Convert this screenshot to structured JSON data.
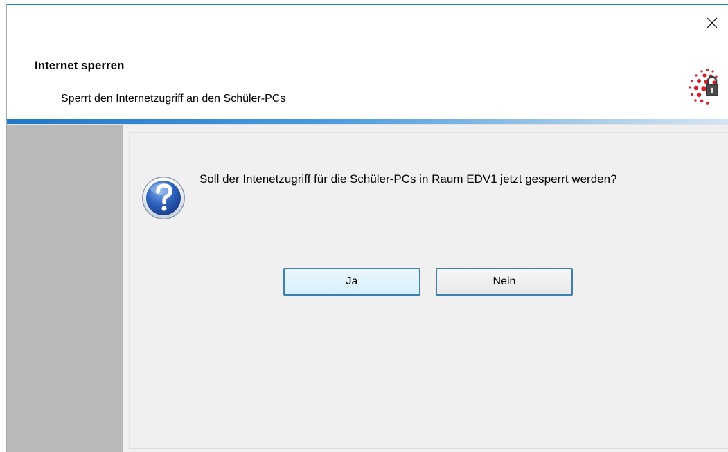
{
  "window": {
    "title": "Internet sperren",
    "subtitle": "Sperrt den Internetzugriff an den Schüler-PCs",
    "close_icon": "close-icon",
    "logo_icon": "lock-logo-icon"
  },
  "dialog": {
    "message": "Soll der Intenetzugriff für die Schüler-PCs in Raum EDV1 jetzt gesperrt werden?",
    "icon": "question-icon",
    "buttons": {
      "yes_label": "Ja",
      "no_label": "Nein"
    }
  },
  "colors": {
    "accent": "#1e78c8",
    "logo_red": "#d8202a",
    "side_panel": "#b9b9b9",
    "content_bg": "#f0f0f0"
  }
}
